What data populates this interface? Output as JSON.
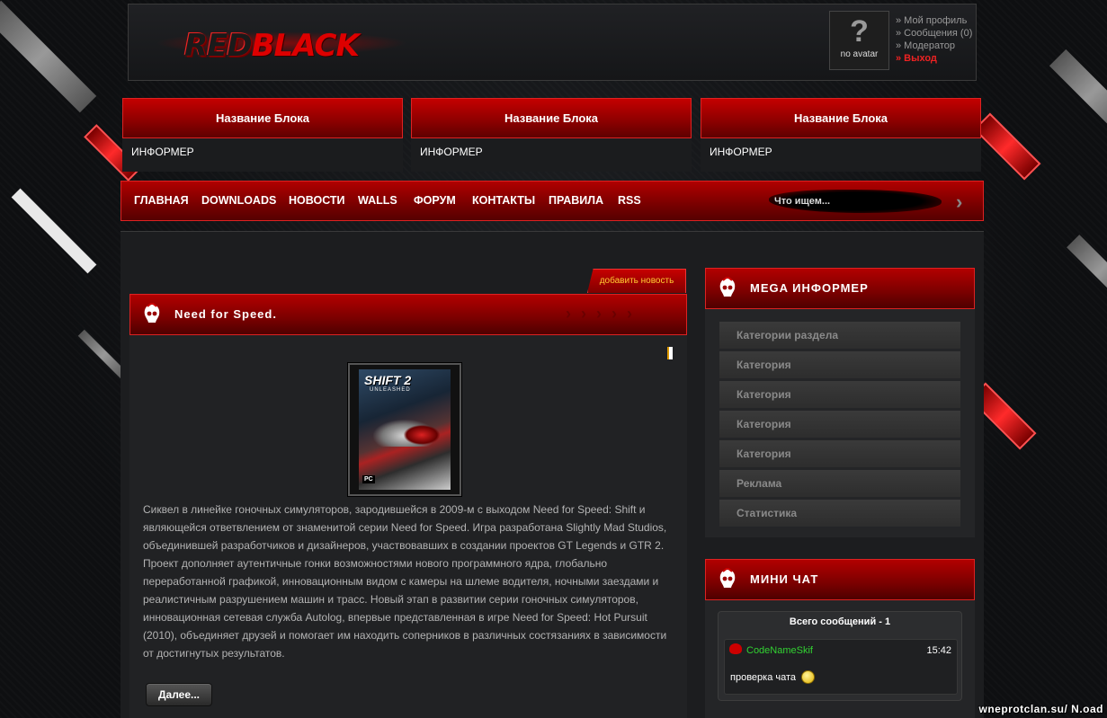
{
  "header": {
    "logo_text_red": "RED",
    "logo_text_black": "BLACK",
    "avatar_mark": "?",
    "avatar_caption": "no avatar",
    "links": [
      "» Мой профиль",
      "» Сообщения (0)",
      "» Модератор"
    ],
    "logout": "» Выход"
  },
  "blocks": [
    {
      "title": "Название Блока",
      "body": "ИНФОРМЕР"
    },
    {
      "title": "Название Блока",
      "body": "ИНФОРМЕР"
    },
    {
      "title": "Название Блока",
      "body": "ИНФОРМЕР"
    }
  ],
  "nav": {
    "items": [
      "ГЛАВНАЯ",
      "DOWNLOADS",
      "НОВОСТИ",
      "WALLS",
      "ФОРУМ",
      "КОНТАКТЫ",
      "ПРАВИЛА",
      "RSS"
    ],
    "search_placeholder": "Что ищем...",
    "search_go": "›"
  },
  "post": {
    "add_news": "добавить новость",
    "title": "Need for Speed.",
    "chevrons": "›››››",
    "cover_title": "SHIFT 2",
    "cover_subtitle": "UNLEASHED",
    "cover_platform": "PC",
    "paragraphs": [
      "Сиквел в линейке гоночных симуляторов, зародившейся в 2009-м с выходом Need for Speed: Shift и являющейся ответвлением от знаменитой серии Need for Speed. Игра разработана Slightly Mad Studios, объединившей разработчиков и дизайнеров, участвовавших в создании проектов GT Legends и GTR 2.",
      "Проект дополняет аутентичные гонки возможностями нового программного ядра, глобально переработанной графикой, инновационным видом с камеры на шлеме водителя, ночными заездами и реалистичным разрушением машин и трасс. Новый этап в развитии серии гоночных симуляторов, инновационная сетевая служба Autolog, впервые представленная в игре Need for Speed: Hot Pursuit (2010), объединяет друзей и помогает им находить соперников в различных состязаниях в зависимости от достигнутых результатов."
    ],
    "more": "Далее..."
  },
  "sidebar": {
    "informer_title": "MEGA ИНФОРМЕР",
    "categories": [
      "Категории раздела",
      "Категория",
      "Категория",
      "Категория",
      "Категория",
      "Реклама",
      "Статистика"
    ],
    "chat_title": "МИНИ ЧАТ",
    "chat_count": "Всего сообщений - 1",
    "chat_user": "CodeNameSkif",
    "chat_time": "15:42",
    "chat_text": "проверка чата"
  },
  "watermark": "wneprotclan.su/ N.oad"
}
